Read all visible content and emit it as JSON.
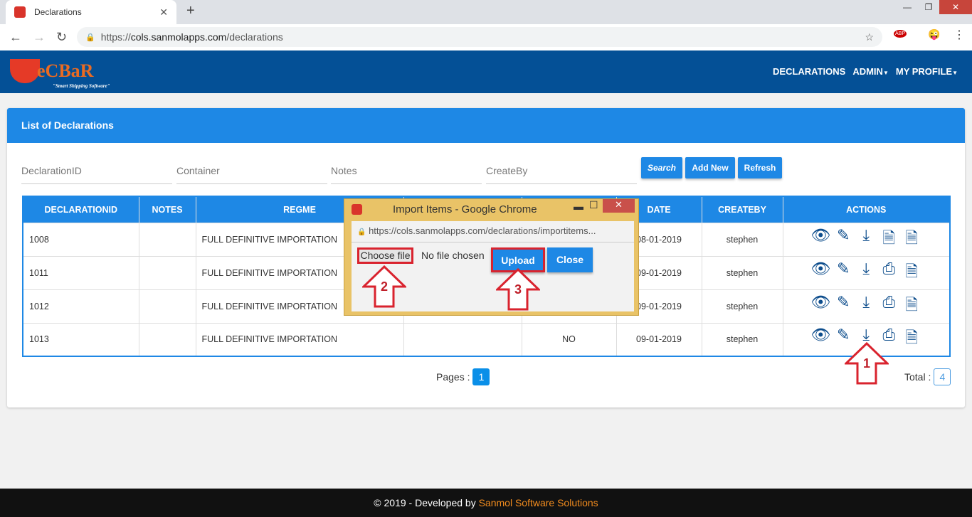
{
  "browser": {
    "tab_title": "Declarations",
    "url_host": "cols.sanmolapps.com",
    "url_scheme": "https://",
    "url_path": "/declarations",
    "ext_abp": "ABP"
  },
  "header": {
    "logo_text": "eCBaR",
    "logo_tagline": "\"Smart Shipping Software\"",
    "menu": [
      "DECLARATIONS",
      "ADMIN",
      "MY PROFILE"
    ]
  },
  "panel": {
    "title": "List of Declarations",
    "filters": [
      {
        "placeholder": "DeclarationID"
      },
      {
        "placeholder": "Container"
      },
      {
        "placeholder": "Notes"
      },
      {
        "placeholder": "CreateBy"
      }
    ],
    "buttons": {
      "search": "Search",
      "add_new": "Add New",
      "refresh": "Refresh"
    }
  },
  "table": {
    "columns": [
      "DECLARATIONID",
      "NOTES",
      "REGME",
      "",
      "",
      "DATE",
      "CREATEBY",
      "ACTIONS"
    ],
    "rows": [
      {
        "cells": [
          "1008",
          "",
          "FULL DEFINITIVE IMPORTATION",
          "",
          "",
          "08-01-2019",
          "stephen"
        ],
        "actions": [
          "view",
          "edit",
          "download",
          "excel",
          "excel"
        ]
      },
      {
        "cells": [
          "1011",
          "",
          "FULL DEFINITIVE IMPORTATION",
          "",
          "",
          "09-01-2019",
          "stephen"
        ],
        "actions": [
          "view",
          "edit",
          "download",
          "print",
          "excel"
        ]
      },
      {
        "cells": [
          "1012",
          "",
          "FULL DEFINITIVE IMPORTATION",
          "",
          "",
          "09-01-2019",
          "stephen"
        ],
        "actions": [
          "view",
          "edit",
          "download",
          "print",
          "excel"
        ]
      },
      {
        "cells": [
          "1013",
          "",
          "FULL DEFINITIVE IMPORTATION",
          "",
          "NO",
          "09-01-2019",
          "stephen"
        ],
        "actions": [
          "view",
          "edit",
          "download",
          "print",
          "excel"
        ]
      }
    ]
  },
  "pagination": {
    "label": "Pages :",
    "current": "1",
    "total_label": "Total :",
    "total": "4"
  },
  "dialog": {
    "title": "Import Items - Google Chrome",
    "url": "https://cols.sanmolapps.com/declarations/importitems...",
    "choose_file": "Choose file",
    "no_file": "No file chosen",
    "upload": "Upload",
    "close": "Close"
  },
  "annotations": [
    "1",
    "2",
    "3"
  ],
  "footer": {
    "prefix": "© 2019 - Developed by ",
    "company": "Sanmol Software Solutions"
  },
  "colors": {
    "header": "#045096",
    "accent": "#1e88e5",
    "annotation": "#d9232e",
    "footer_link": "#f28c1e"
  }
}
